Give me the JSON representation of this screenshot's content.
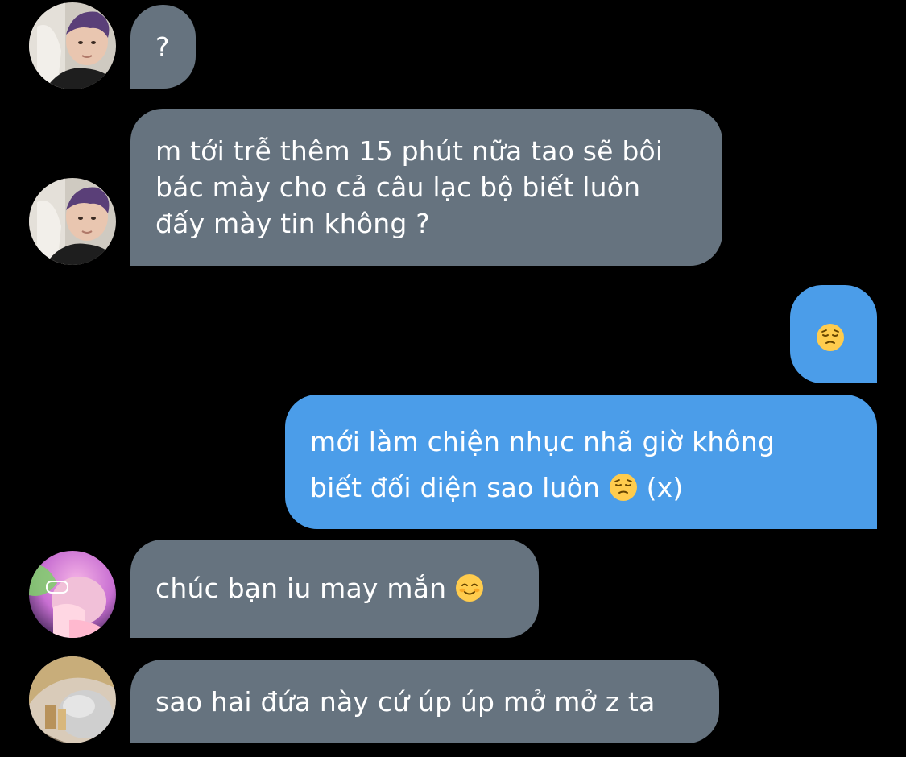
{
  "messages": [
    {
      "sender": "incoming",
      "avatar": "avatar-purple-hair",
      "lines": [
        "?"
      ]
    },
    {
      "sender": "incoming",
      "avatar": "avatar-purple-hair",
      "lines": [
        "m tới trễ thêm 15 phút nữa tao sẽ bôi",
        "bác mày cho cả câu lạc bộ biết luôn",
        "đấy mày tin không ?"
      ]
    },
    {
      "sender": "outgoing",
      "lines": [
        ""
      ],
      "emoji": "pensive-face-icon"
    },
    {
      "sender": "outgoing",
      "lines": [
        "mới làm chiện nhục nhã giờ không",
        "biết đối diện sao luôn"
      ],
      "line2_suffix": "(x)",
      "emoji": "pensive-face-icon"
    },
    {
      "sender": "incoming",
      "avatar": "avatar-pink-light",
      "lines": [
        "chúc bạn iu may mắn"
      ],
      "emoji": "smiling-face-icon"
    },
    {
      "sender": "incoming",
      "avatar": "avatar-light-hair",
      "lines": [
        "sao hai đứa này cứ úp úp mở mở z ta"
      ]
    }
  ],
  "colors": {
    "background": "#000000",
    "incoming_bubble": "#66737f",
    "outgoing_bubble": "#4b9de9",
    "text": "#ffffff"
  }
}
